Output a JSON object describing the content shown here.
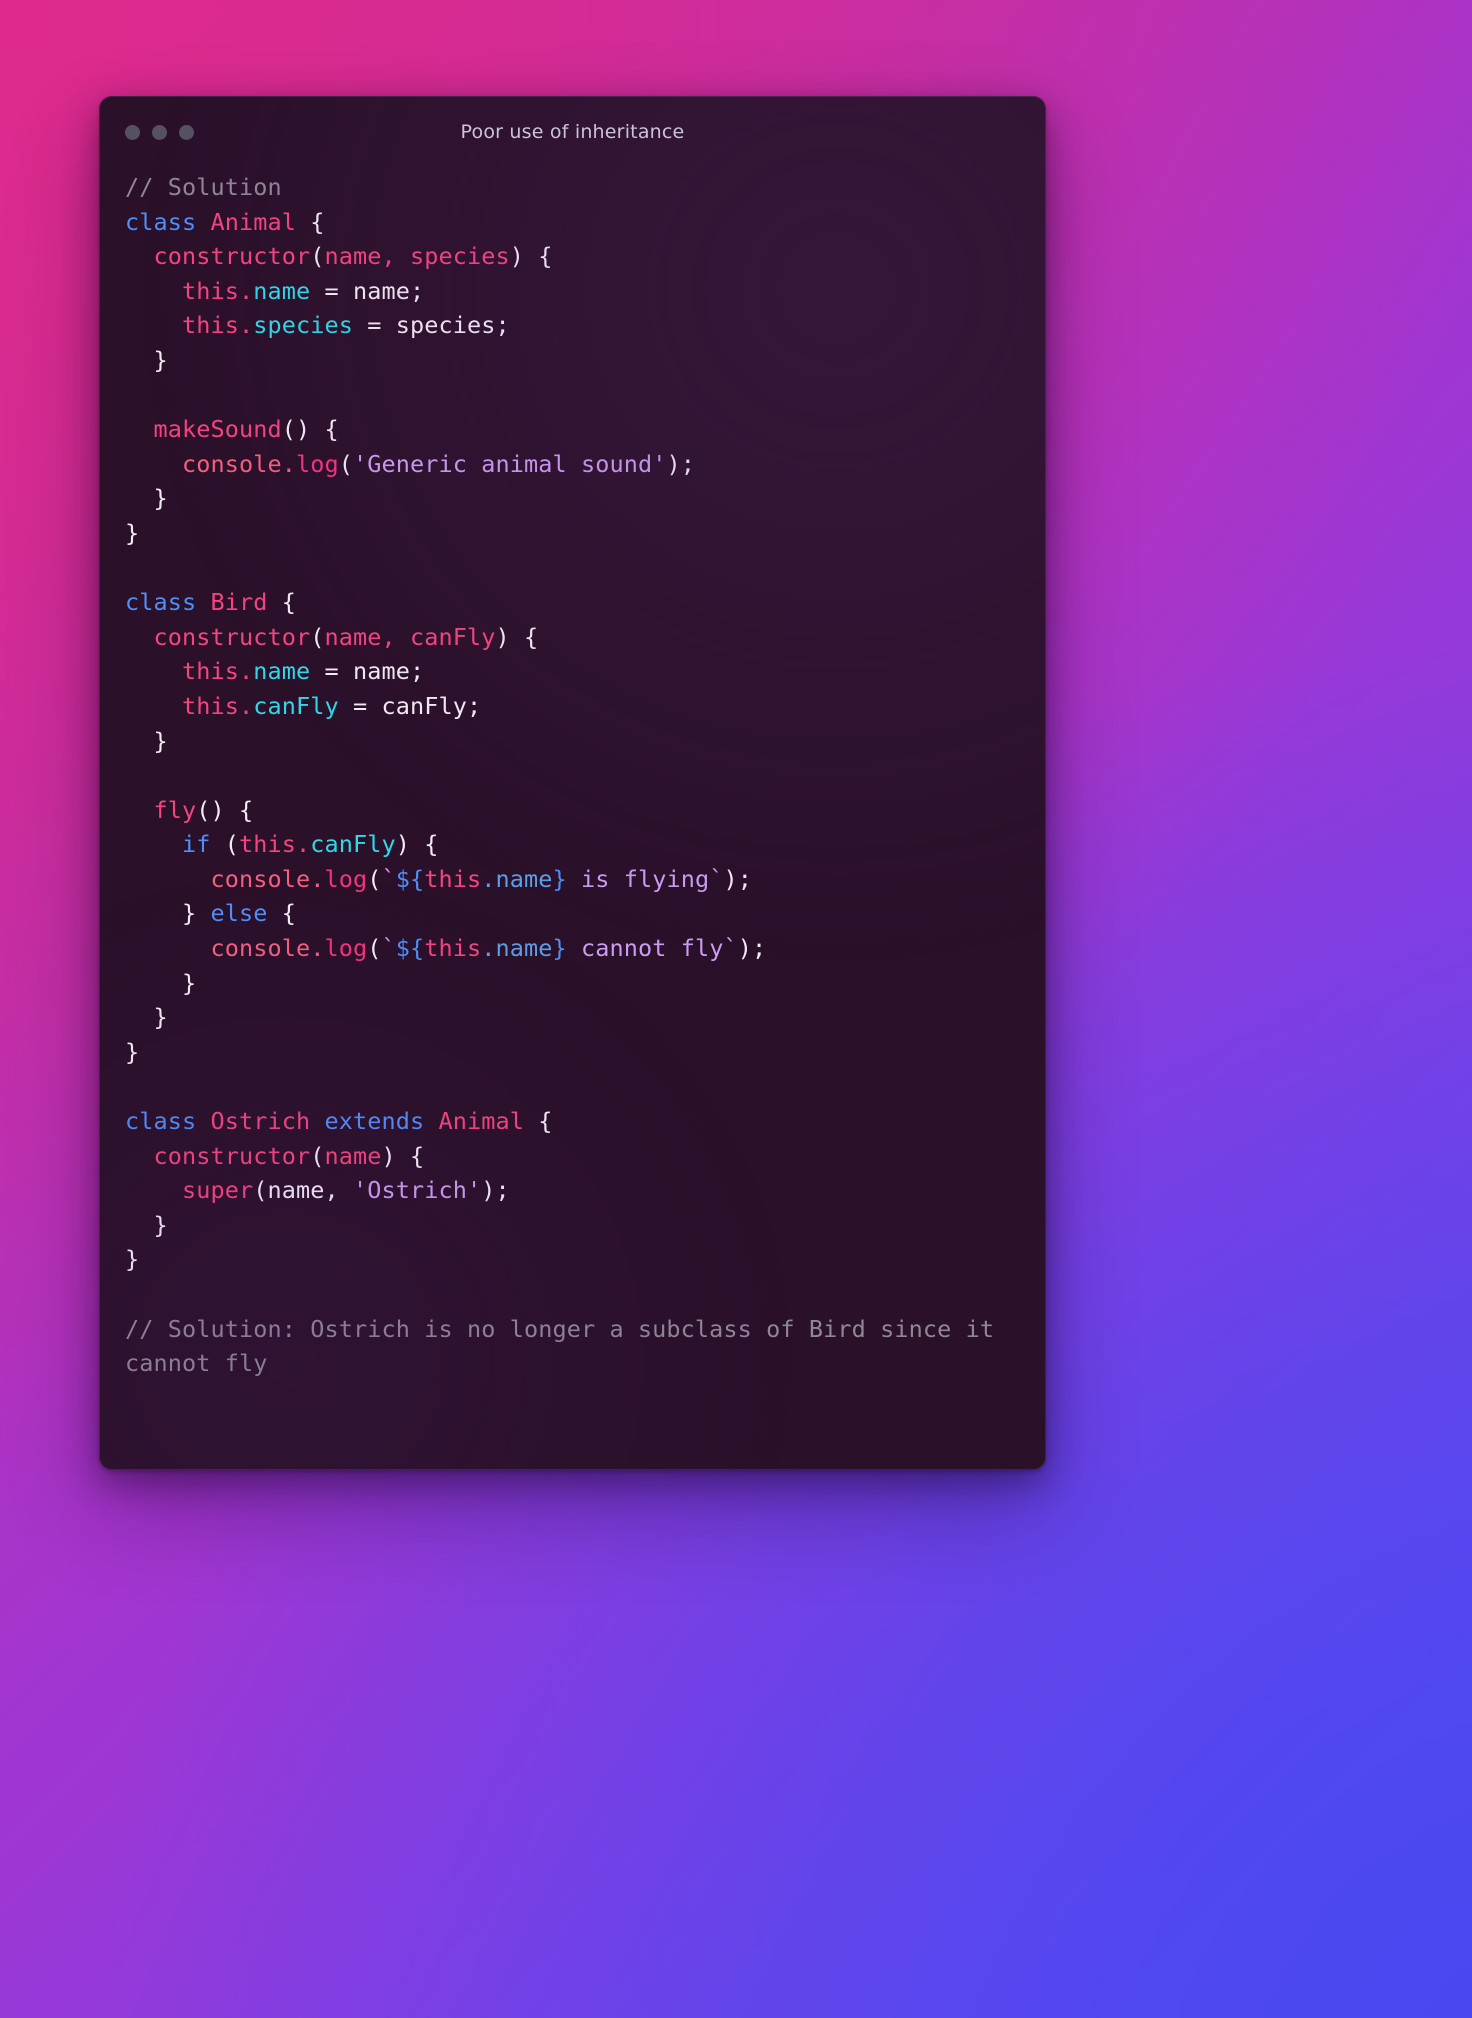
{
  "window": {
    "title": "Poor use of inheritance",
    "traffic_lights": [
      "close-dot",
      "minimize-dot",
      "maximize-dot"
    ],
    "background_color": "#2a1029",
    "accent_gradient": [
      "#d62a92",
      "#a435cf",
      "#5548f2"
    ]
  },
  "theme": {
    "comment": "#8f8796",
    "keyword": "#4f8ff7",
    "class_name": "#f4457f",
    "function": "#f4457f",
    "this_keyword": "#f4457f",
    "property": "#2fd9e8",
    "plain": "#f2ecf5",
    "string": "#cb9cf0",
    "console_object": "#f4607f",
    "log_method": "#f4347f",
    "interpolation": "#4f8ff7"
  },
  "code": {
    "language": "javascript",
    "lines": [
      {
        "id": "l1",
        "text": "// Solution"
      },
      {
        "id": "l2",
        "text": "class Animal {"
      },
      {
        "id": "l3",
        "text": "  constructor(name, species) {"
      },
      {
        "id": "l4",
        "text": "    this.name = name;"
      },
      {
        "id": "l5",
        "text": "    this.species = species;"
      },
      {
        "id": "l6",
        "text": "  }"
      },
      {
        "id": "l7",
        "text": ""
      },
      {
        "id": "l8",
        "text": "  makeSound() {"
      },
      {
        "id": "l9",
        "text": "    console.log('Generic animal sound');"
      },
      {
        "id": "l10",
        "text": "  }"
      },
      {
        "id": "l11",
        "text": "}"
      },
      {
        "id": "l12",
        "text": ""
      },
      {
        "id": "l13",
        "text": "class Bird {"
      },
      {
        "id": "l14",
        "text": "  constructor(name, canFly) {"
      },
      {
        "id": "l15",
        "text": "    this.name = name;"
      },
      {
        "id": "l16",
        "text": "    this.canFly = canFly;"
      },
      {
        "id": "l17",
        "text": "  }"
      },
      {
        "id": "l18",
        "text": ""
      },
      {
        "id": "l19",
        "text": "  fly() {"
      },
      {
        "id": "l20",
        "text": "    if (this.canFly) {"
      },
      {
        "id": "l21",
        "text": "      console.log(`${this.name} is flying`);"
      },
      {
        "id": "l22",
        "text": "    } else {"
      },
      {
        "id": "l23",
        "text": "      console.log(`${this.name} cannot fly`);"
      },
      {
        "id": "l24",
        "text": "    }"
      },
      {
        "id": "l25",
        "text": "  }"
      },
      {
        "id": "l26",
        "text": "}"
      },
      {
        "id": "l27",
        "text": ""
      },
      {
        "id": "l28",
        "text": "class Ostrich extends Animal {"
      },
      {
        "id": "l29",
        "text": "  constructor(name) {"
      },
      {
        "id": "l30",
        "text": "    super(name, 'Ostrich');"
      },
      {
        "id": "l31",
        "text": "  }"
      },
      {
        "id": "l32",
        "text": "}"
      },
      {
        "id": "l33",
        "text": ""
      },
      {
        "id": "l34",
        "text": "// Solution: Ostrich is no longer a subclass of Bird since it cannot fly"
      }
    ],
    "tokens": {
      "l1": [
        [
          "// Solution",
          "comment"
        ]
      ],
      "l2": [
        [
          "class",
          "key"
        ],
        [
          " ",
          "plain"
        ],
        [
          "Animal",
          "class"
        ],
        [
          " ",
          "plain"
        ],
        [
          "{",
          "punct"
        ]
      ],
      "l3": [
        [
          "  ",
          "plain"
        ],
        [
          "constructor",
          "fn"
        ],
        [
          "(",
          "punct"
        ],
        [
          "name",
          "param"
        ],
        [
          ", ",
          "param"
        ],
        [
          "species",
          "param"
        ],
        [
          ")",
          "punct"
        ],
        [
          " ",
          "plain"
        ],
        [
          "{",
          "punct"
        ]
      ],
      "l4": [
        [
          "    ",
          "plain"
        ],
        [
          "this",
          "this"
        ],
        [
          ".",
          "this"
        ],
        [
          "name",
          "prop"
        ],
        [
          " = ",
          "plain"
        ],
        [
          "name;",
          "plain"
        ]
      ],
      "l5": [
        [
          "    ",
          "plain"
        ],
        [
          "this",
          "this"
        ],
        [
          ".",
          "this"
        ],
        [
          "species",
          "prop"
        ],
        [
          " = ",
          "plain"
        ],
        [
          "species;",
          "plain"
        ]
      ],
      "l6": [
        [
          "  }",
          "punct"
        ]
      ],
      "l7": [],
      "l8": [
        [
          "  ",
          "plain"
        ],
        [
          "makeSound",
          "fn"
        ],
        [
          "()",
          "punct"
        ],
        [
          " ",
          "plain"
        ],
        [
          "{",
          "punct"
        ]
      ],
      "l9": [
        [
          "    ",
          "plain"
        ],
        [
          "console",
          "console"
        ],
        [
          ".",
          "console"
        ],
        [
          "log",
          "log"
        ],
        [
          "(",
          "punct"
        ],
        [
          "'Generic animal sound'",
          "string"
        ],
        [
          ")",
          "punct"
        ],
        [
          ";",
          "punct"
        ]
      ],
      "l10": [
        [
          "  }",
          "punct"
        ]
      ],
      "l11": [
        [
          "}",
          "punct"
        ]
      ],
      "l12": [],
      "l13": [
        [
          "class",
          "key"
        ],
        [
          " ",
          "plain"
        ],
        [
          "Bird",
          "class"
        ],
        [
          " ",
          "plain"
        ],
        [
          "{",
          "punct"
        ]
      ],
      "l14": [
        [
          "  ",
          "plain"
        ],
        [
          "constructor",
          "fn"
        ],
        [
          "(",
          "punct"
        ],
        [
          "name",
          "param"
        ],
        [
          ", ",
          "param"
        ],
        [
          "canFly",
          "param"
        ],
        [
          ")",
          "punct"
        ],
        [
          " ",
          "plain"
        ],
        [
          "{",
          "punct"
        ]
      ],
      "l15": [
        [
          "    ",
          "plain"
        ],
        [
          "this",
          "this"
        ],
        [
          ".",
          "this"
        ],
        [
          "name",
          "prop"
        ],
        [
          " = ",
          "plain"
        ],
        [
          "name;",
          "plain"
        ]
      ],
      "l16": [
        [
          "    ",
          "plain"
        ],
        [
          "this",
          "this"
        ],
        [
          ".",
          "this"
        ],
        [
          "canFly",
          "prop"
        ],
        [
          " = ",
          "plain"
        ],
        [
          "canFly;",
          "plain"
        ]
      ],
      "l17": [
        [
          "  }",
          "punct"
        ]
      ],
      "l18": [],
      "l19": [
        [
          "  ",
          "plain"
        ],
        [
          "fly",
          "fn"
        ],
        [
          "()",
          "punct"
        ],
        [
          " ",
          "plain"
        ],
        [
          "{",
          "punct"
        ]
      ],
      "l20": [
        [
          "    ",
          "plain"
        ],
        [
          "if",
          "key"
        ],
        [
          " ",
          "plain"
        ],
        [
          "(",
          "punct"
        ],
        [
          "this",
          "this"
        ],
        [
          ".",
          "this"
        ],
        [
          "canFly",
          "prop"
        ],
        [
          ")",
          "punct"
        ],
        [
          " ",
          "plain"
        ],
        [
          "{",
          "punct"
        ]
      ],
      "l21": [
        [
          "      ",
          "plain"
        ],
        [
          "console",
          "console"
        ],
        [
          ".",
          "console"
        ],
        [
          "log",
          "log"
        ],
        [
          "(",
          "punct"
        ],
        [
          "`",
          "string"
        ],
        [
          "${",
          "interp"
        ],
        [
          "this",
          "this"
        ],
        [
          ".",
          "interp-prop"
        ],
        [
          "name",
          "interp-prop"
        ],
        [
          "}",
          "interp"
        ],
        [
          " is flying",
          "string"
        ],
        [
          "`",
          "string"
        ],
        [
          ")",
          "punct"
        ],
        [
          ";",
          "punct"
        ]
      ],
      "l22": [
        [
          "    }",
          "punct"
        ],
        [
          " ",
          "plain"
        ],
        [
          "else",
          "key"
        ],
        [
          " ",
          "plain"
        ],
        [
          "{",
          "punct"
        ]
      ],
      "l23": [
        [
          "      ",
          "plain"
        ],
        [
          "console",
          "console"
        ],
        [
          ".",
          "console"
        ],
        [
          "log",
          "log"
        ],
        [
          "(",
          "punct"
        ],
        [
          "`",
          "string"
        ],
        [
          "${",
          "interp"
        ],
        [
          "this",
          "this"
        ],
        [
          ".",
          "interp-prop"
        ],
        [
          "name",
          "interp-prop"
        ],
        [
          "}",
          "interp"
        ],
        [
          " cannot fly",
          "string"
        ],
        [
          "`",
          "string"
        ],
        [
          ")",
          "punct"
        ],
        [
          ";",
          "punct"
        ]
      ],
      "l24": [
        [
          "    }",
          "punct"
        ]
      ],
      "l25": [
        [
          "  }",
          "punct"
        ]
      ],
      "l26": [
        [
          "}",
          "punct"
        ]
      ],
      "l27": [],
      "l28": [
        [
          "class",
          "key"
        ],
        [
          " ",
          "plain"
        ],
        [
          "Ostrich",
          "class"
        ],
        [
          " ",
          "plain"
        ],
        [
          "extends",
          "key"
        ],
        [
          " ",
          "plain"
        ],
        [
          "Animal",
          "class"
        ],
        [
          " ",
          "plain"
        ],
        [
          "{",
          "punct"
        ]
      ],
      "l29": [
        [
          "  ",
          "plain"
        ],
        [
          "constructor",
          "fn"
        ],
        [
          "(",
          "punct"
        ],
        [
          "name",
          "param"
        ],
        [
          ")",
          "punct"
        ],
        [
          " ",
          "plain"
        ],
        [
          "{",
          "punct"
        ]
      ],
      "l30": [
        [
          "    ",
          "plain"
        ],
        [
          "super",
          "fn"
        ],
        [
          "(",
          "punct"
        ],
        [
          "name",
          "plain"
        ],
        [
          ", ",
          "plain"
        ],
        [
          "'Ostrich'",
          "string"
        ],
        [
          ")",
          "punct"
        ],
        [
          ";",
          "punct"
        ]
      ],
      "l31": [
        [
          "  }",
          "punct"
        ]
      ],
      "l32": [
        [
          "}",
          "punct"
        ]
      ],
      "l33": [],
      "l34": [
        [
          "// Solution: Ostrich is no longer a subclass of Bird since it cannot fly",
          "comment"
        ]
      ]
    }
  }
}
